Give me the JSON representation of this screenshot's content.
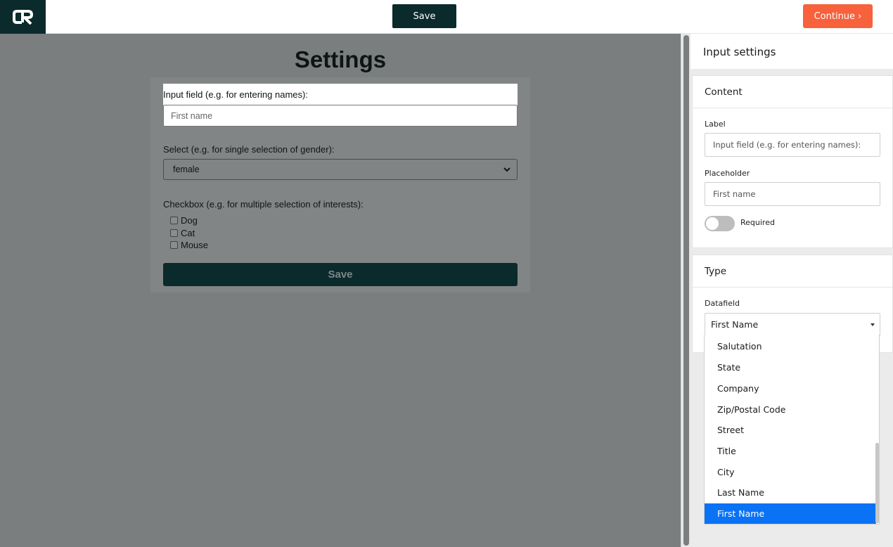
{
  "topbar": {
    "logo_text": "CR",
    "save_label": "Save",
    "continue_label": "Continue ›"
  },
  "canvas": {
    "title": "Settings",
    "input_label": "Input field (e.g. for entering names):",
    "input_placeholder": "First name",
    "select_label": "Select (e.g. for single selection of gender):",
    "select_value": "female",
    "checkbox_label": "Checkbox (e.g. for multiple selection of interests):",
    "checkboxes": [
      "Dog",
      "Cat",
      "Mouse"
    ],
    "save_label": "Save"
  },
  "panel": {
    "title": "Input settings",
    "content": {
      "heading": "Content",
      "label_label": "Label",
      "label_value": "Input field (e.g. for entering names):",
      "placeholder_label": "Placeholder",
      "placeholder_value": "First name",
      "required_label": "Required",
      "required_on": false
    },
    "type": {
      "heading": "Type",
      "datafield_label": "Datafield",
      "datafield_value": "First Name",
      "options": [
        "Salutation",
        "State",
        "Company",
        "Zip/Postal Code",
        "Street",
        "Title",
        "City",
        "Last Name",
        "First Name"
      ],
      "selected_option": "First Name"
    }
  },
  "colors": {
    "brand_dark": "#0b2a2c",
    "accent_orange": "#f7613b",
    "selection_blue": "#0a72f5",
    "overlay_gray": "#7b7e7e"
  },
  "icons": {
    "logo": "cr-logo-icon",
    "select_chevron": "chevron-down-icon",
    "dropdown_caret": "caret-down-icon"
  }
}
